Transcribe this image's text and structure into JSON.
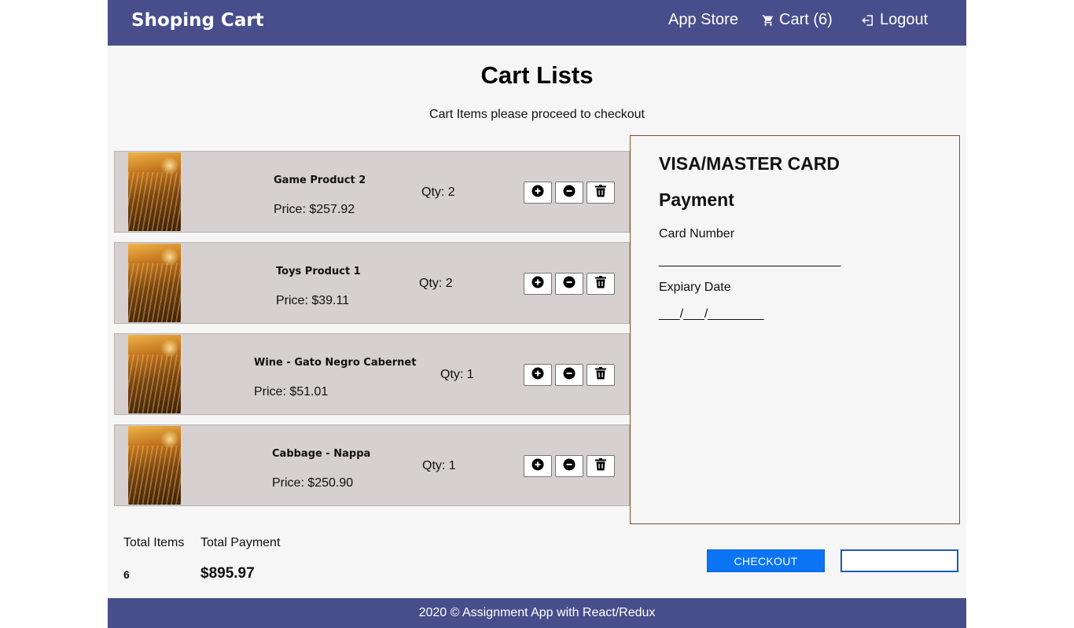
{
  "navbar": {
    "brand": "Shoping Cart",
    "links": {
      "app_store": "App Store",
      "cart": "Cart (6)",
      "logout": "Logout"
    },
    "icons": {
      "cart": "shopping-cart-icon",
      "logout": "logout-icon"
    }
  },
  "page": {
    "title": "Cart Lists",
    "subtitle": "Cart Items please proceed to checkout"
  },
  "cart": {
    "items": [
      {
        "name": "Game Product 2",
        "price": "Price: $257.92",
        "qty": "Qty: 2"
      },
      {
        "name": "Toys Product 1",
        "price": "Price: $39.11",
        "qty": "Qty: 2"
      },
      {
        "name": "Wine - Gato Negro Cabernet",
        "price": "Price: $51.01",
        "qty": "Qty: 1"
      },
      {
        "name": "Cabbage - Nappa",
        "price": "Price: $250.90",
        "qty": "Qty: 1"
      }
    ],
    "item_actions": [
      "plus-circle-icon",
      "minus-circle-icon",
      "trash-icon"
    ]
  },
  "payment": {
    "brand": "VISA/MASTER CARD",
    "heading": "Payment",
    "card_number_label": "Card Number",
    "card_number_value": "__________________________",
    "expiry_label": "Expiary Date",
    "expiry_value": "___/___/________"
  },
  "totals": {
    "items_label": "Total Items",
    "items_value": "6",
    "payment_label": "Total Payment",
    "payment_value": "$895.97"
  },
  "actions": {
    "checkout_label": "CHECKOUT",
    "input_value": ""
  },
  "footer": {
    "text": "2020 © Assignment App with React/Redux"
  },
  "colors": {
    "navbar": "#484e8b",
    "item_bg": "#d6d0d0",
    "payment_border": "#8b4a2b",
    "checkout": "#0a74f5"
  }
}
